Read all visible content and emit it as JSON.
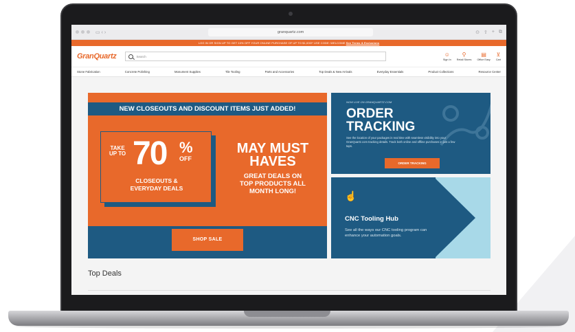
{
  "browser": {
    "url": "granquartz.com"
  },
  "promo": {
    "text": "LOG IN OR SIGN UP TO GET 10% OFF YOUR ONLINE PURCHASE OF UP TO $1,000!* USE CODE: WELCOME",
    "link": "See Terms & Exclusions"
  },
  "header": {
    "logo": "GranQuartz",
    "search_placeholder": "Search",
    "actions": [
      {
        "label": "Sign In",
        "icon": "person-icon"
      },
      {
        "label": "Retail Stores",
        "icon": "location-pin-icon"
      },
      {
        "label": "Office Easy",
        "icon": "document-icon"
      },
      {
        "label": "Cart",
        "icon": "cart-icon"
      }
    ]
  },
  "nav": {
    "items": [
      "Stone Fabrication",
      "Concrete Polishing",
      "Monument Supplies",
      "Tile Tooling",
      "Parts and Accessories",
      "Top Deals & New Arrivals",
      "Everyday Essentials",
      "Product Collections",
      "Resource Center"
    ]
  },
  "hero": {
    "banner": "NEW CLOSEOUTS AND DISCOUNT ITEMS JUST ADDED!",
    "take": "TAKE",
    "up_to": "UP TO",
    "percent": "70",
    "percent_sign": "%",
    "off": "OFF",
    "closeouts": "CLOSEOUTS &",
    "everyday": "EVERYDAY DEALS",
    "may_line1": "MAY MUST",
    "may_line2": "HAVES",
    "great_line1": "GREAT DEALS ON",
    "great_line2": "TOP PRODUCTS ALL",
    "great_line3": "MONTH LONG!",
    "cta": "SHOP SALE"
  },
  "order": {
    "kicker": "NOW LIVE ON GRANQUARTZ.COM",
    "title_line1": "ORDER",
    "title_line2": "TRACKING",
    "desc": "See the location of your packages in real time with seamless visibility into your GranQuartz.com tracking details. Track both online and offline purchases in just a few taps.",
    "cta": "ORDER TRACKING"
  },
  "cnc": {
    "title": "CNC Tooling Hub",
    "desc": "See all the ways our CNC tooling program can enhance your automation goals."
  },
  "sections": {
    "top_deals": "Top Deals"
  },
  "colors": {
    "brand_orange": "#e8692b",
    "brand_blue": "#1e5a82",
    "light_blue": "#a8d9e8"
  }
}
